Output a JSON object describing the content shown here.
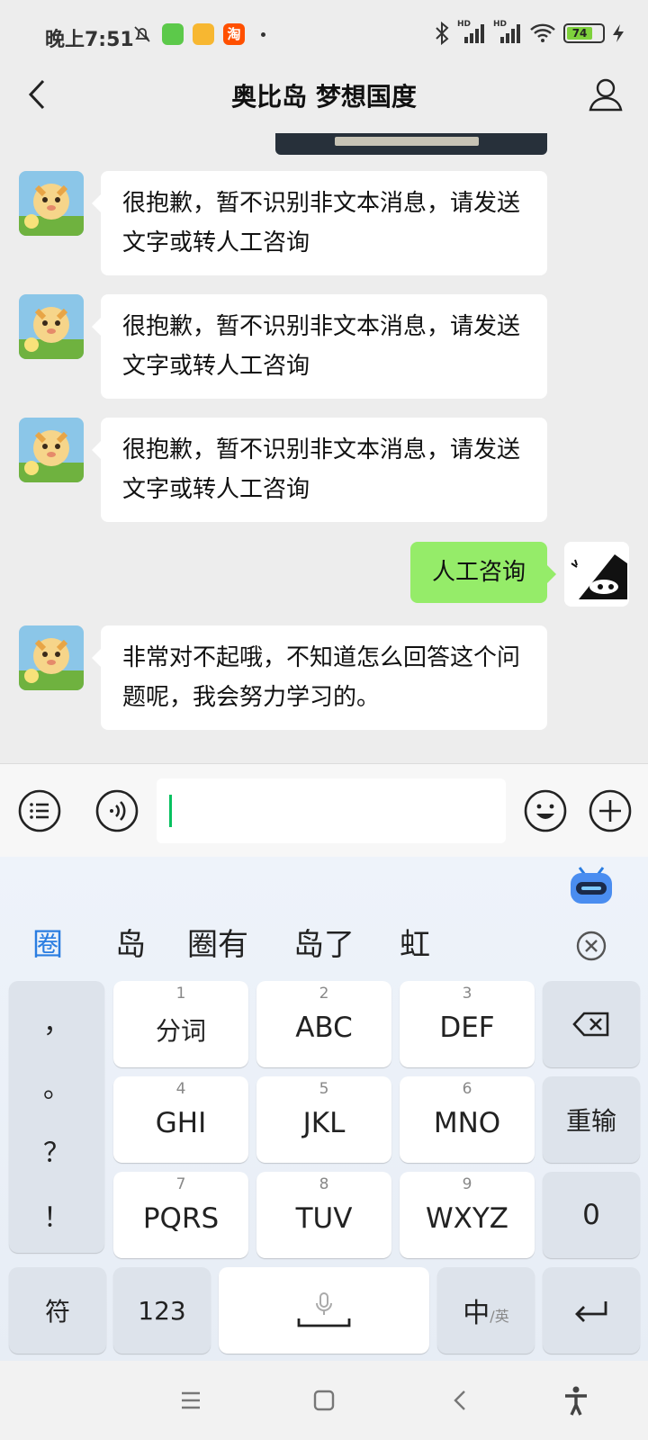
{
  "status_bar": {
    "time": "晚上7:51",
    "battery_level": "74",
    "battery_color": "#7ed13c",
    "icons": [
      "mute-bell-icon",
      "app-icon-green",
      "app-icon-yellow",
      "taobao-icon",
      "bluetooth-icon",
      "signal-hd-icon",
      "signal-hd-icon-2",
      "wifi-icon",
      "charging-icon"
    ],
    "taobao_label": "淘",
    "hd1": "HD",
    "hd2": "HD"
  },
  "nav": {
    "title": "奥比岛 梦想国度"
  },
  "chat": {
    "messages": [
      {
        "from": "bot",
        "text": "很抱歉，暂不识别非文本消息，请发送文字或转人工咨询"
      },
      {
        "from": "bot",
        "text": "很抱歉，暂不识别非文本消息，请发送文字或转人工咨询"
      },
      {
        "from": "bot",
        "text": "很抱歉，暂不识别非文本消息，请发送文字或转人工咨询"
      },
      {
        "from": "me",
        "text": "人工咨询"
      },
      {
        "from": "bot",
        "text": "非常对不起哦，不知道怎么回答这个问题呢，我会努力学习的。"
      }
    ]
  },
  "input_bar": {
    "text_value": "",
    "accent_color": "#07c160"
  },
  "keyboard": {
    "candidates": [
      "圈",
      "岛",
      "圈有",
      "岛了",
      "虹"
    ],
    "punctuation": [
      "，",
      "。",
      "？",
      "！"
    ],
    "keys": [
      {
        "num": "1",
        "label": "分词"
      },
      {
        "num": "2",
        "label": "ABC"
      },
      {
        "num": "3",
        "label": "DEF"
      },
      {
        "num": "4",
        "label": "GHI"
      },
      {
        "num": "5",
        "label": "JKL"
      },
      {
        "num": "6",
        "label": "MNO"
      },
      {
        "num": "7",
        "label": "PQRS"
      },
      {
        "num": "8",
        "label": "TUV"
      },
      {
        "num": "9",
        "label": "WXYZ"
      }
    ],
    "reenter_label": "重输",
    "zero_label": "0",
    "symbol_label": "符",
    "numeric_label": "123",
    "lang_main": "中",
    "lang_sub": "/英",
    "highlight_color": "#2a7de1"
  }
}
